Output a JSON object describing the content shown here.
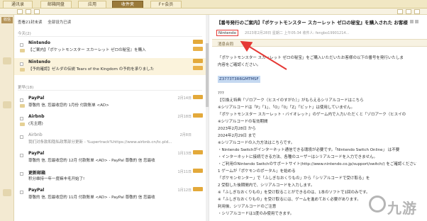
{
  "top_tabs": [
    {
      "label": "通讯录"
    },
    {
      "label": "邮箱网盘"
    },
    {
      "label": "应用"
    },
    {
      "label": "收件夹"
    },
    {
      "label": "F+会员"
    }
  ],
  "rail": {
    "label": "收信"
  },
  "list": {
    "filters": [
      "查看21封未读",
      "全部设为已读"
    ],
    "dates": [
      "今天(2)",
      "更早(18)"
    ],
    "mails": [
      {
        "from": "Nintendo",
        "subject": "【ご案内】『ポケットモンスター スカーレット ゼロの秘宝』を購入",
        "time": "",
        "badge": "",
        "icon": ""
      },
      {
        "from": "Nintendo",
        "subject": "【予約確認】ゼルダの伝説 Tears of the Kingdom の予約を承りました",
        "time": "",
        "badge": "",
        "icon": ""
      },
      {
        "from": "PayPal",
        "subject": "尊敬的 信, 您最收您的 1月份 付款账单 <AD>",
        "time": "2月14日",
        "badge": "",
        "icon": ""
      },
      {
        "from": "Airbnb",
        "subject": "(无主题)",
        "time": "2月18日",
        "badge": "",
        "icon": ""
      },
      {
        "from": "Airbnb",
        "subject": "我们对条款和隐私政策部分更新 - %upertrack%https://www.airbnb.cn/tc.pld...",
        "time": "2月8日",
        "badge": "",
        "icon": ""
      },
      {
        "from": "PayPal",
        "subject": "尊敬的 信, 您最收您的 12月 付款账单 <AD> - PayPal 尊敬的 信 您最收",
        "time": "1月13日",
        "badge": "",
        "icon": ""
      },
      {
        "from": "更新邮箱",
        "subject": "积分维持一年一度嘛丰毛开始了!",
        "time": "1月11日",
        "badge": "",
        "icon": ""
      },
      {
        "from": "PayPal",
        "subject": "尊敬的 信, 您最收您的 11月 付款账单 <AD> - PayPal 尊敬的 信 您最收",
        "time": "1月12日",
        "badge": "",
        "icon": ""
      }
    ]
  },
  "read": {
    "title": "【番号発行のご案内】『ポケットモンスター スカーレット ゼロの秘宝』を購入された お客様へ",
    "sender": "Nintendo",
    "sender_meta": "2023年2月28日 星期二 上午05:34 收件人: fengbo19901214...",
    "tab": "消息合同",
    "body_lines": [
      "「ポケットモンスター スカーレット ゼロの秘宝」をご購入いただいたお客様の以下の番号を発行いたしま",
      "内容をご確認ください。",
      "",
      "",
      "",
      "???",
      "【引換え特典「ゾロアーク（ヒスイのすがた）」がもらえるシリアルコードはこちら",
      "※シリアルコードは「P」「1」、「O」「0」「Z」「ビット」は使用していません。",
      "「ポケットモンスター スカーレット・バイオレット」のゲーム内で入力いただくと「ゾロアーク（ヒスイの",
      "※シリアルコードの有効期間",
      "2023年2月28日 から",
      "2024年2月29日 まで",
      "※シリアルコードの入力方法はこちらです。",
      "・Nintendo Switchがインターネット通信できる環境が必要です。「Nintendo Switch Online」 は不要",
      "・インターネットに接続できる方法、各種のユーザーはシリアルコードを入力できません。",
      "・ご利用のNintendo Switchのサポートサイト(http://www.nintendo.co.jp/support/switch/) をご確認ください",
      "1 ゲームが「ポケモンのポータル」を始める",
      "「ポケモンセンター」で「ふしぎなおくりもの」から「シリアルコードで受け取る」を",
      "2 受取した後期間内で、シリアルコードを入力します。",
      "※「ふしぎなおくりもの」を受け取ることができるのは、1本のソフトで1回のみです。",
      "※「ふしぎなおくりもの」を受け取るには、ゲームを進めておく必要があります。",
      "利用後、シリアルコードのご注意",
      "・シリアルコードは1度のみ使用できます。"
    ],
    "code": "Z3773T3R6GMTMSF"
  },
  "watermark": {
    "text": "九游"
  },
  "colors": {
    "accent": "#9a7a3a",
    "highlight_border": "#e53935",
    "badge": "#e3a93a",
    "selection": "#c5d9f1"
  }
}
